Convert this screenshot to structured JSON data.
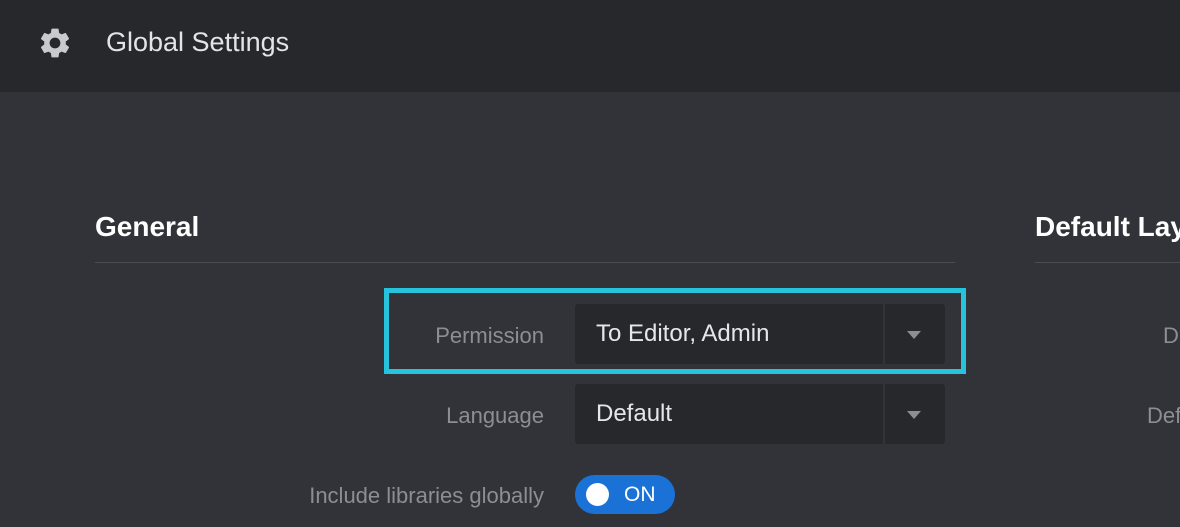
{
  "header": {
    "icon": "gear-icon",
    "title": "Global Settings"
  },
  "general": {
    "title": "General",
    "permission": {
      "label": "Permission",
      "value": "To Editor, Admin"
    },
    "language": {
      "label": "Language",
      "value": "Default"
    },
    "include_libraries": {
      "label": "Include libraries globally",
      "toggle_text": "ON",
      "state": true
    }
  },
  "default_layout": {
    "title": "Default Lay",
    "row1_label": "D",
    "row2_label": "Def"
  },
  "colors": {
    "highlight": "#27c3dc",
    "toggle_on": "#1a72d6"
  }
}
